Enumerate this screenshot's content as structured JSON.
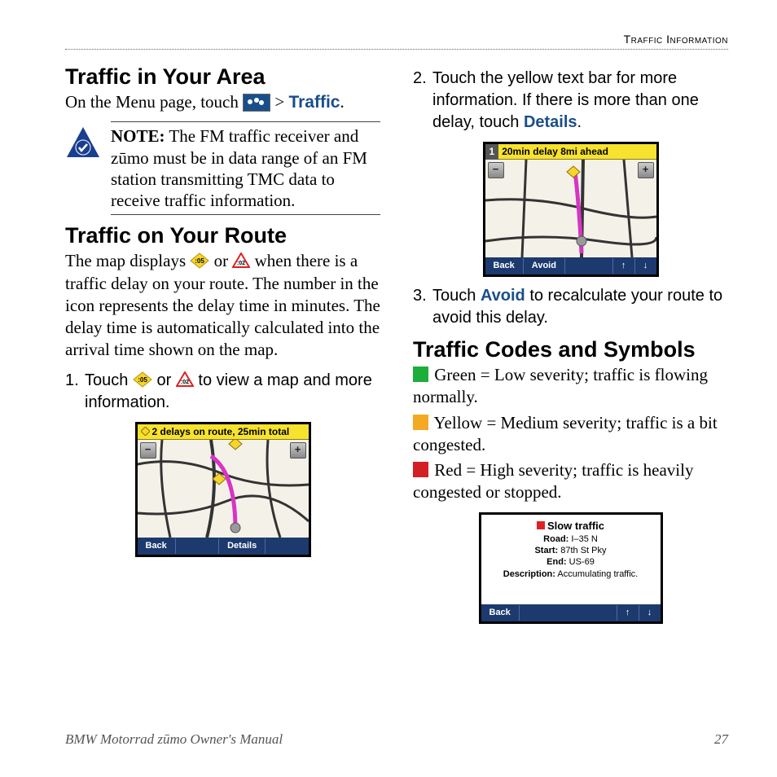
{
  "header": "Traffic Information",
  "left": {
    "h1": "Traffic in Your Area",
    "p1a": "On the Menu page, touch ",
    "p1b": " > ",
    "p1c": "Traffic",
    "p1d": ".",
    "note_label": "NOTE:",
    "note_body": " The FM traffic receiver and zūmo must be in data range of an FM station transmitting TMC data to receive traffic information.",
    "h2": "Traffic on Your Route",
    "p2a": "The map displays ",
    "p2b": " or ",
    "p2c": " when there is a traffic delay on your route. The number in the icon represents the delay time in minutes. The delay time is automatically calculated into the arrival time shown on the map.",
    "step1_num": "1.",
    "step1a": "Touch  ",
    "step1b": " or ",
    "step1c": " to view a map and more information.",
    "screenshot1": {
      "bar": "2 delays on route, 25min total",
      "back": "Back",
      "details": "Details"
    }
  },
  "right": {
    "step2_num": "2.",
    "step2a": "Touch the yellow text bar for more information. If there is more than one delay, touch ",
    "step2_details": "Details",
    "step2b": ".",
    "screenshot2": {
      "bar": "20min delay 8mi ahead",
      "back": "Back",
      "avoid": "Avoid",
      "tab": "1"
    },
    "step3_num": "3.",
    "step3a": "Touch ",
    "step3_avoid": "Avoid",
    "step3b": " to recalculate your route to avoid this delay.",
    "h3": "Traffic Codes and Symbols",
    "green": " Green = Low severity; traffic is flowing normally.",
    "yellow": " Yellow = Medium severity; traffic is a bit congested.",
    "red": " Red = High severity; traffic is heavily congested or stopped.",
    "colors": {
      "green": "#1dae3a",
      "yellow": "#f5a821",
      "red": "#d32024"
    },
    "detail": {
      "title": "Slow traffic",
      "road_label": "Road:",
      "road": " I–35 N",
      "start_label": "Start:",
      "start": " 87th St Pky",
      "end_label": "End:",
      "end": " US-69",
      "desc_label": "Description:",
      "desc": " Accumulating traffic.",
      "back": "Back"
    }
  },
  "footer": {
    "title": "BMW Motorrad zūmo Owner's Manual",
    "page": "27"
  }
}
